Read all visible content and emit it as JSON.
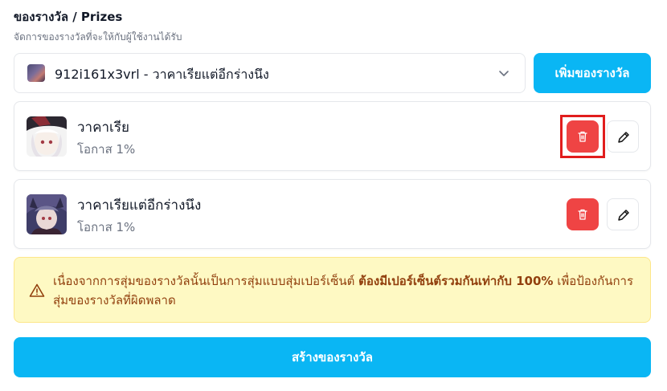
{
  "header": {
    "title": "ของรางวัล / Prizes",
    "subtitle": "จัดการของรางวัลที่จะให้กับผู้ใช้งานได้รับ"
  },
  "selector": {
    "selected_code": "912i161x3vrl",
    "selected_separator": " - ",
    "selected_name": "วาคาเรียแต่อีกร่างนึง"
  },
  "add_button": {
    "label": "เพิ่มของรางวัล"
  },
  "prizes": [
    {
      "name": "วาคาเรีย",
      "chance": "โอกาส 1%"
    },
    {
      "name": "วาคาเรียแต่อีกร่างนึง",
      "chance": "โอกาส 1%"
    }
  ],
  "warning": {
    "text_before": "เนื่องจากการสุ่มของรางวัลนั้นเป็นการสุ่มแบบสุ่มเปอร์เซ็นต์ ",
    "text_bold": "ต้องมีเปอร์เซ็นต์รวมกันเท่ากับ 100%",
    "text_after": " เพื่อป้องกันการสุ่มของรางวัลที่ผิดพลาด"
  },
  "create_button": {
    "label": "สร้างของรางวัล"
  },
  "colors": {
    "primary": "#0ab6f4",
    "danger": "#ef4444",
    "warning_bg": "#fef9c3",
    "warning_text": "#92400e",
    "highlight": "#e11d1d"
  },
  "icons": {
    "chevron": "chevron-down-icon",
    "delete": "trash-icon",
    "edit": "pencil-icon",
    "warning": "warning-triangle-icon"
  }
}
